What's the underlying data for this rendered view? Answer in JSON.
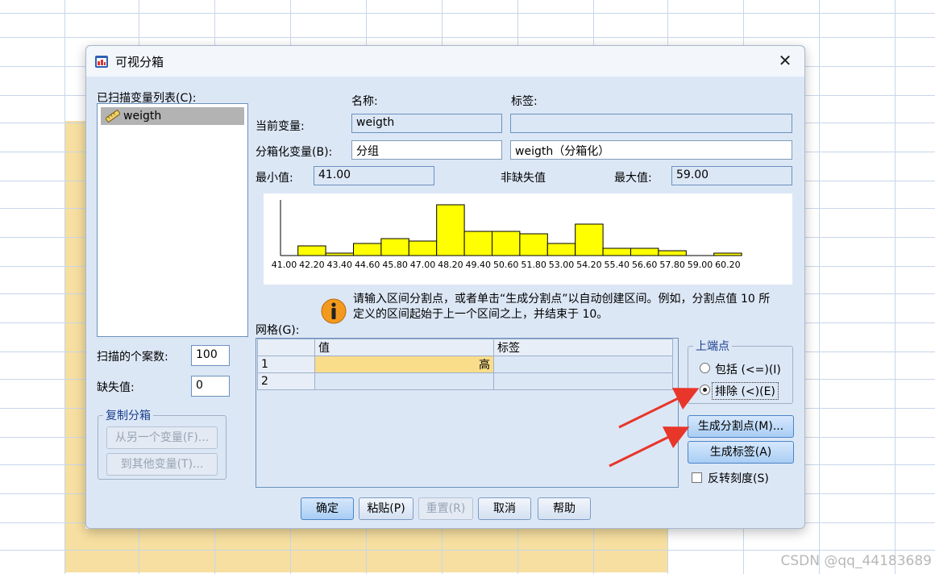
{
  "dialog": {
    "title": "可视分箱",
    "scanned_list_label": "已扫描变量列表(C):",
    "variables": [
      "weigth"
    ],
    "name_header": "名称:",
    "label_header": "标签:",
    "current_var_label": "当前变量:",
    "current_var_name": "weigth",
    "current_var_tag": "",
    "binned_var_label": "分箱化变量(B):",
    "binned_var_name": "分组",
    "binned_var_tag": "weigth（分箱化）",
    "min_label": "最小值:",
    "min_value": "41.00",
    "nonmissing_label": "非缺失值",
    "max_label": "最大值:",
    "max_value": "59.00",
    "cases_label": "扫描的个案数:",
    "cases_value": "100",
    "missing_label": "缺失值:",
    "missing_value": "0",
    "copy_group": {
      "legend": "复制分箱",
      "from_button": "从另一个变量(F)...",
      "to_button": "到其他变量(T)..."
    },
    "info_text_line1": "请输入区间分割点，或者单击“生成分割点”以自动创建区间。例如，分割点值 10 所",
    "info_text_line2": "定义的区间起始于上一个区间之上，并结束于 10。",
    "grid_label": "网格(G):",
    "grid_headers": [
      "值",
      "标签"
    ],
    "grid_rows": [
      {
        "num": "1",
        "value": "高",
        "label": ""
      },
      {
        "num": "2",
        "value": "",
        "label": ""
      }
    ],
    "endpoint_group": {
      "legend": "上端点",
      "include_label": "包括 (<=)(I)",
      "exclude_label": "排除 (<)(E)",
      "selected": "exclude"
    },
    "make_cutpoints_button": "生成分割点(M)...",
    "make_labels_button": "生成标签(A)",
    "reverse_scale_label": "反转刻度(S)",
    "footer_buttons": {
      "ok": "确定",
      "paste": "粘贴(P)",
      "reset": "重置(R)",
      "cancel": "取消",
      "help": "帮助"
    }
  },
  "chart_data": {
    "type": "bar",
    "categories": [
      "41.00",
      "42.20",
      "43.40",
      "44.60",
      "45.80",
      "47.00",
      "48.20",
      "49.40",
      "50.60",
      "51.80",
      "53.00",
      "54.20",
      "55.40",
      "56.60",
      "57.80",
      "59.00",
      "60.20"
    ],
    "tick_labels": [
      "41.00",
      "42.20",
      "43.40",
      "44.60",
      "45.80",
      "47.00",
      "48.20",
      "49.40",
      "50.60",
      "51.80",
      "53.00",
      "54.20",
      "55.40",
      "56.60",
      "57.80",
      "59.00",
      "60.20"
    ],
    "values": [
      0,
      4,
      1,
      5,
      7,
      6,
      21,
      10,
      10,
      9,
      5,
      13,
      3,
      3,
      2,
      0,
      1
    ],
    "bar_color": "#ffff00",
    "ylim": [
      0,
      23
    ]
  },
  "watermark": "CSDN @qq_44183689",
  "colors": {
    "dialog_bg": "#dce7f6",
    "cell_highlight": "#f9dd8a",
    "arrow": "#e8362a"
  }
}
